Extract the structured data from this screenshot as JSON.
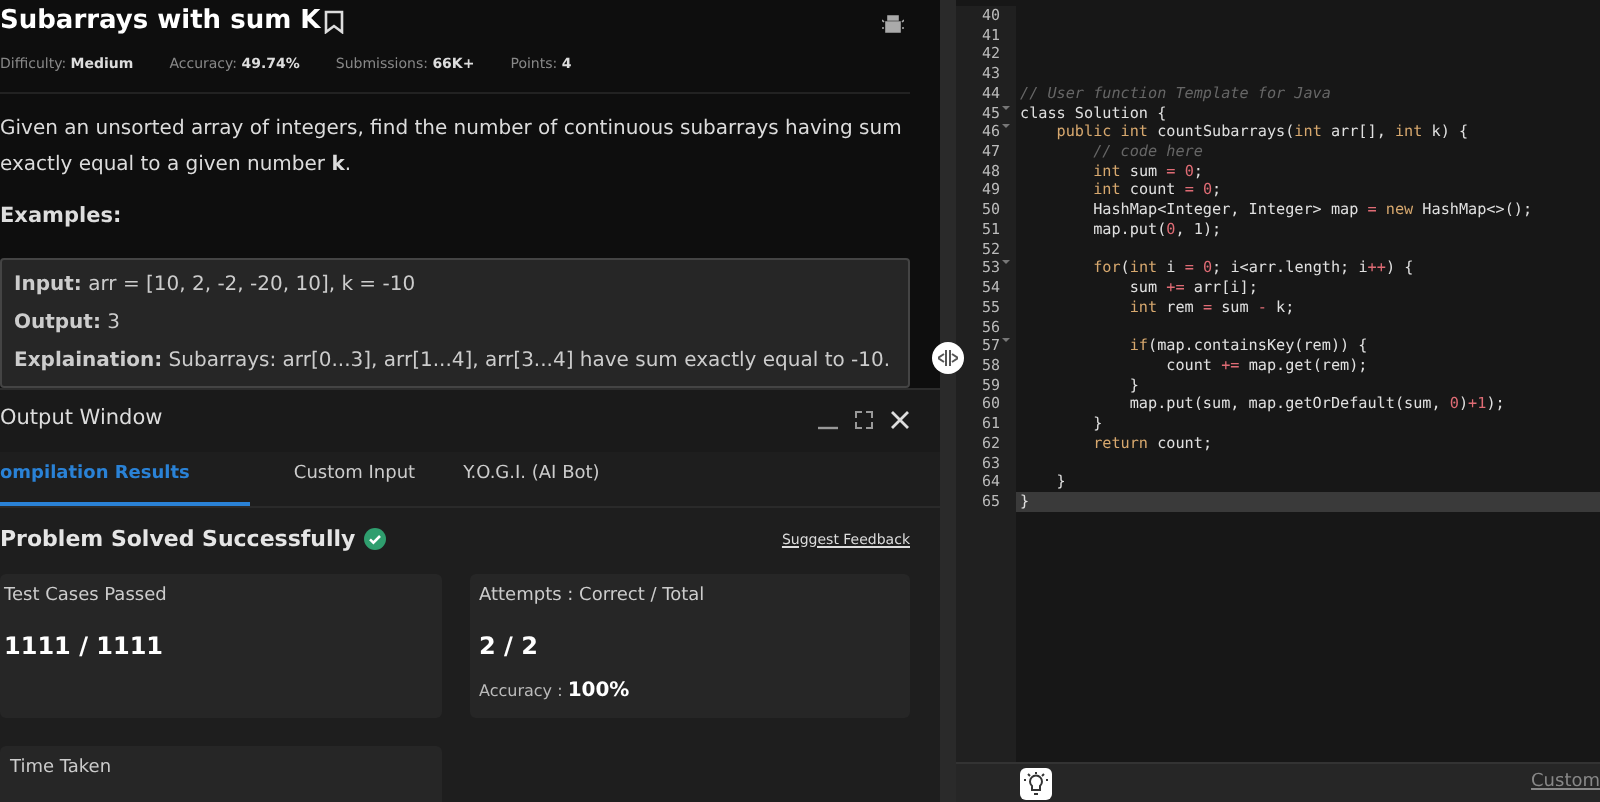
{
  "problem": {
    "title": "Subarrays with sum K",
    "meta": [
      {
        "label": "Difficulty:",
        "value": "Medium"
      },
      {
        "label": "Accuracy:",
        "value": "49.74%"
      },
      {
        "label": "Submissions:",
        "value": "66K+"
      },
      {
        "label": "Points:",
        "value": "4"
      }
    ],
    "description": "Given an unsorted array of integers, find the number of continuous subarrays having sum exactly equal to a given number **k**.",
    "examples_heading": "Examples:",
    "example_lines": [
      "**Input:** arr = [10, 2, -2, -20, 10], k = -10",
      "**Output:** 3",
      "**Explaination:** Subarrays: arr[0...3], arr[1...4], arr[3...4] have sum exactly equal to -10."
    ]
  },
  "output_window": {
    "title": "Output Window",
    "tabs": [
      {
        "label": "ompilation Results",
        "selected": true
      },
      {
        "label": "Custom Input",
        "selected": false
      },
      {
        "label": "Y.O.G.I. (AI Bot)",
        "selected": false
      }
    ],
    "status": "Problem Solved Successfully",
    "feedback_link": "Suggest Feedback",
    "cards": [
      {
        "label": "Test Cases Passed",
        "value": "1111 / 1111"
      },
      {
        "label": "Attempts : Correct / Total",
        "value": "2 / 2",
        "sub_label": "Accuracy :",
        "sub_value": "100%"
      },
      {
        "label": "Time Taken"
      }
    ]
  },
  "editor": {
    "lines": [
      {
        "n": "40"
      },
      {
        "n": "41"
      },
      {
        "n": "42"
      },
      {
        "n": "43"
      },
      {
        "n": "44",
        "tokens": [
          {
            "t": "// User function Template for Java",
            "kind": "comment"
          }
        ]
      },
      {
        "n": "45",
        "fold": true,
        "tokens": [
          {
            "t": "class Solution {",
            "kind": "plain"
          }
        ]
      },
      {
        "n": "46",
        "fold": true,
        "tokens": [
          {
            "t": "    public int",
            "kind": "keyword"
          },
          {
            "t": " countSubarrays(",
            "kind": "plain"
          },
          {
            "t": "int",
            "kind": "keyword"
          },
          {
            "t": " arr[], ",
            "kind": "plain"
          },
          {
            "t": "int",
            "kind": "keyword"
          },
          {
            "t": " k) {",
            "kind": "plain"
          }
        ]
      },
      {
        "n": "47",
        "tokens": [
          {
            "t": "        // code here",
            "kind": "comment"
          }
        ]
      },
      {
        "n": "48",
        "tokens": [
          {
            "t": "        int",
            "kind": "keyword"
          },
          {
            "t": " sum ",
            "kind": "plain"
          },
          {
            "t": "= ",
            "kind": "operator"
          },
          {
            "t": "0",
            "kind": "number"
          },
          {
            "t": ";",
            "kind": "plain"
          }
        ]
      },
      {
        "n": "49",
        "tokens": [
          {
            "t": "        int",
            "kind": "keyword"
          },
          {
            "t": " count ",
            "kind": "plain"
          },
          {
            "t": "= ",
            "kind": "operator"
          },
          {
            "t": "0",
            "kind": "number"
          },
          {
            "t": ";",
            "kind": "plain"
          }
        ]
      },
      {
        "n": "50",
        "tokens": [
          {
            "t": "        HashMap<Integer, Integer> map ",
            "kind": "plain"
          },
          {
            "t": "= ",
            "kind": "operator"
          },
          {
            "t": "new",
            "kind": "keyword"
          },
          {
            "t": " HashMap<>();",
            "kind": "plain"
          }
        ]
      },
      {
        "n": "51",
        "tokens": [
          {
            "t": "        map.put(",
            "kind": "plain"
          },
          {
            "t": "0",
            "kind": "number"
          },
          {
            "t": ", 1);",
            "kind": "plain"
          }
        ]
      },
      {
        "n": "52"
      },
      {
        "n": "53",
        "fold": true,
        "tokens": [
          {
            "t": "        for",
            "kind": "keyword"
          },
          {
            "t": "(",
            "kind": "plain"
          },
          {
            "t": "int",
            "kind": "keyword"
          },
          {
            "t": " i ",
            "kind": "plain"
          },
          {
            "t": "= ",
            "kind": "operator"
          },
          {
            "t": "0",
            "kind": "number"
          },
          {
            "t": "; i<arr.length; i",
            "kind": "plain"
          },
          {
            "t": "++",
            "kind": "operator"
          },
          {
            "t": ") {",
            "kind": "plain"
          }
        ]
      },
      {
        "n": "54",
        "tokens": [
          {
            "t": "            sum ",
            "kind": "plain"
          },
          {
            "t": "+=",
            "kind": "operator"
          },
          {
            "t": " arr[i];",
            "kind": "plain"
          }
        ]
      },
      {
        "n": "55",
        "tokens": [
          {
            "t": "            int",
            "kind": "keyword"
          },
          {
            "t": " rem ",
            "kind": "plain"
          },
          {
            "t": "=",
            "kind": "operator"
          },
          {
            "t": " sum ",
            "kind": "plain"
          },
          {
            "t": "-",
            "kind": "operator"
          },
          {
            "t": " k;",
            "kind": "plain"
          }
        ]
      },
      {
        "n": "56"
      },
      {
        "n": "57",
        "fold": true,
        "tokens": [
          {
            "t": "            if",
            "kind": "keyword"
          },
          {
            "t": "(map.containsKey(rem)) {",
            "kind": "plain"
          }
        ]
      },
      {
        "n": "58",
        "tokens": [
          {
            "t": "                count ",
            "kind": "plain"
          },
          {
            "t": "+=",
            "kind": "operator"
          },
          {
            "t": " map.get(rem);",
            "kind": "plain"
          }
        ]
      },
      {
        "n": "59",
        "tokens": [
          {
            "t": "            }",
            "kind": "plain"
          }
        ]
      },
      {
        "n": "60",
        "tokens": [
          {
            "t": "            map.put(sum, map.getOrDefault(sum, ",
            "kind": "plain"
          },
          {
            "t": "0",
            "kind": "number"
          },
          {
            "t": ")",
            "kind": "plain"
          },
          {
            "t": "+1",
            "kind": "operator"
          },
          {
            "t": ");",
            "kind": "plain"
          }
        ]
      },
      {
        "n": "61",
        "tokens": [
          {
            "t": "        }",
            "kind": "plain"
          }
        ]
      },
      {
        "n": "62",
        "tokens": [
          {
            "t": "        return",
            "kind": "keyword"
          },
          {
            "t": " count;",
            "kind": "plain"
          }
        ]
      },
      {
        "n": "63"
      },
      {
        "n": "64",
        "tokens": [
          {
            "t": "    }",
            "kind": "plain"
          }
        ]
      },
      {
        "n": "65",
        "current": true,
        "tokens": [
          {
            "t": "}",
            "kind": "plain"
          }
        ]
      }
    ],
    "footer_link": "Custom"
  }
}
